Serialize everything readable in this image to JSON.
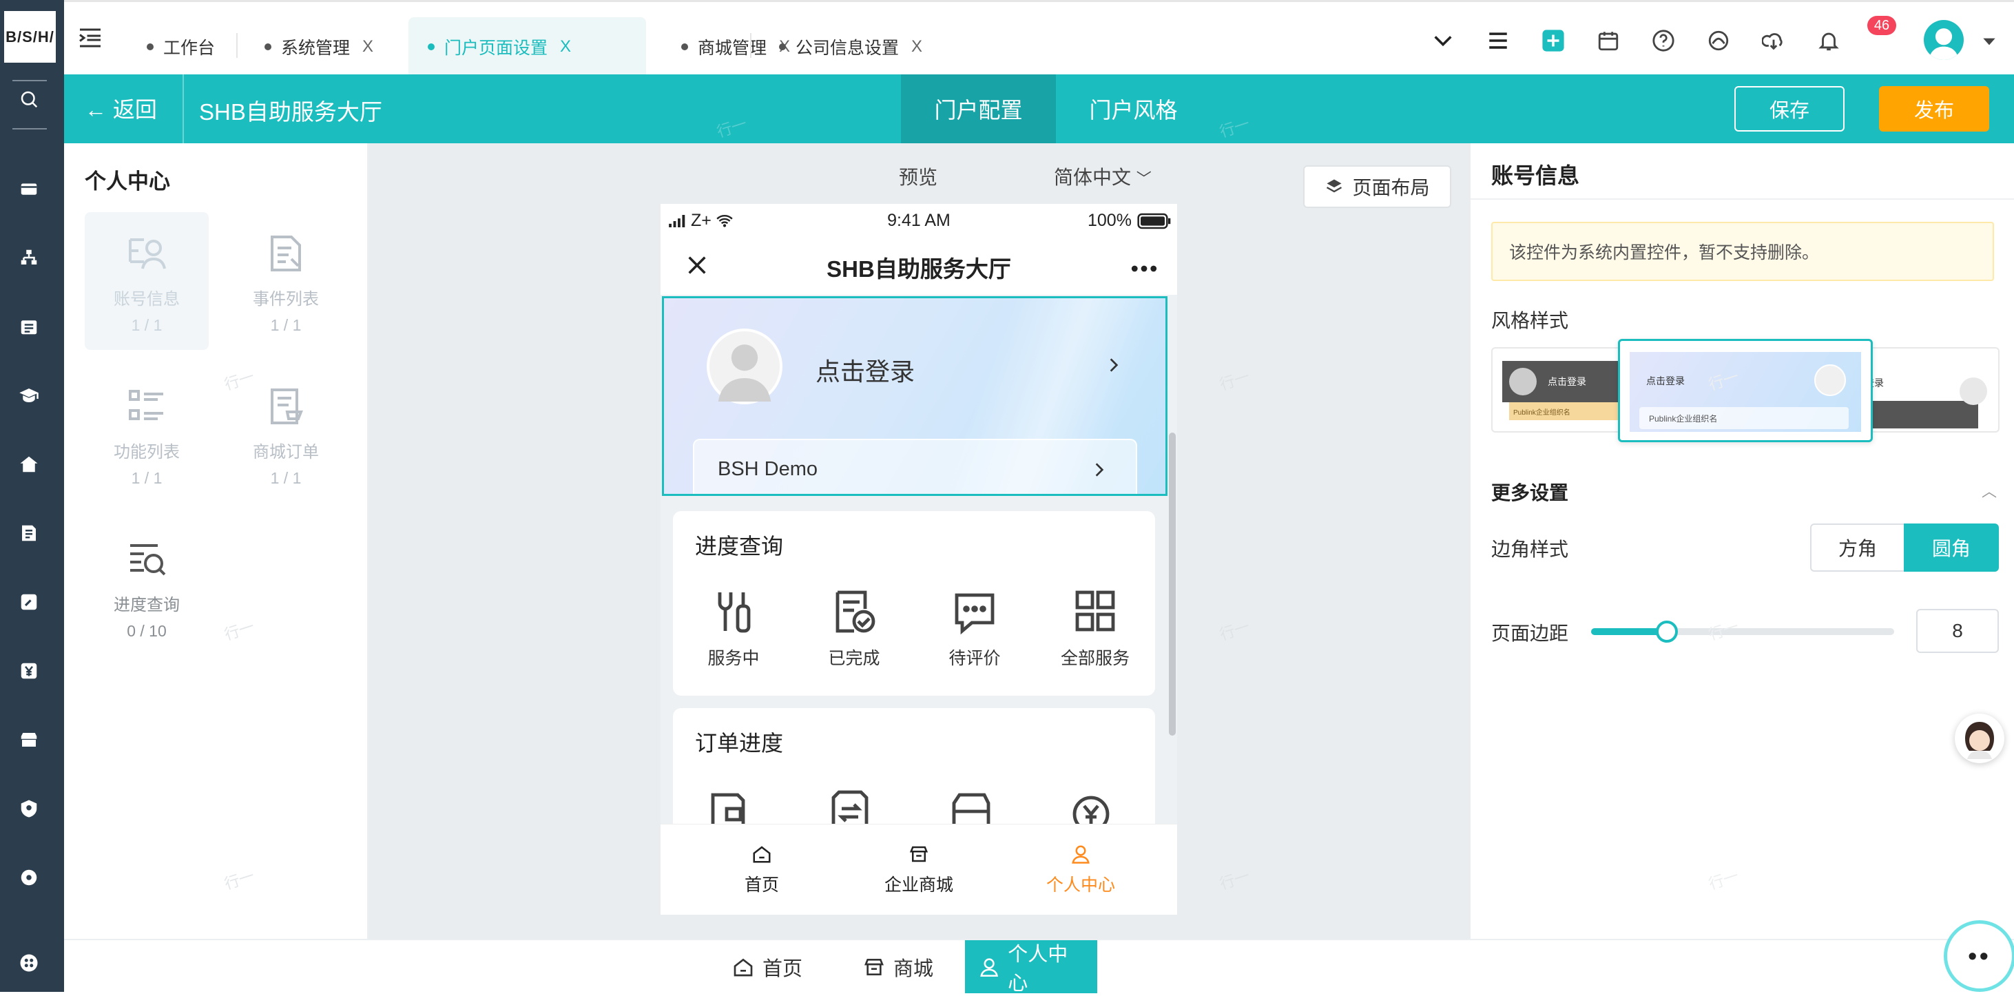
{
  "app": {
    "logo_text": "B/S/H/"
  },
  "tabs": [
    {
      "label": "工作台",
      "closable": false
    },
    {
      "label": "系统管理",
      "closable": true
    },
    {
      "label": "门户页面设置",
      "closable": true,
      "active": true
    },
    {
      "label": "商城管理",
      "closable": true
    },
    {
      "label": "公司信息设置",
      "closable": true
    }
  ],
  "tab_close_glyph": "X",
  "notification_count": "46",
  "header": {
    "back_label": "返回",
    "page_title": "SHB自助服务大厅",
    "config_tab": "门户配置",
    "style_tab": "门户风格",
    "save_label": "保存",
    "publish_label": "发布"
  },
  "left_panel": {
    "title": "个人中心",
    "components": [
      {
        "name": "账号信息",
        "count": "1 / 1",
        "icon": "account-icon"
      },
      {
        "name": "事件列表",
        "count": "1 / 1",
        "icon": "event-list-icon"
      },
      {
        "name": "功能列表",
        "count": "1 / 1",
        "icon": "function-list-icon"
      },
      {
        "name": "商城订单",
        "count": "1 / 1",
        "icon": "mall-order-icon"
      },
      {
        "name": "进度查询",
        "count": "0 / 10",
        "icon": "progress-query-icon"
      }
    ]
  },
  "canvas": {
    "preview_label": "预览",
    "language": "简体中文",
    "layout_button": "页面布局"
  },
  "phone": {
    "carrier": "Z+",
    "time": "9:41 AM",
    "battery": "100%",
    "title": "SHB自助服务大厅",
    "login_text": "点击登录",
    "company": "BSH Demo",
    "progress_card": {
      "title": "进度查询",
      "items": [
        "服务中",
        "已完成",
        "待评价",
        "全部服务"
      ]
    },
    "order_card": {
      "title": "订单进度"
    },
    "tabbar": [
      "首页",
      "企业商城",
      "个人中心"
    ],
    "active_tab_color": "#ff8a1c"
  },
  "right_panel": {
    "title": "账号信息",
    "notice": "该控件为系统内置控件，暂不支持删除。",
    "style_label": "风格样式",
    "style_thumbs": [
      {
        "login": "点击登录",
        "org": "Publink企业组织名"
      },
      {
        "login": "点击登录",
        "org": "Publink企业组织名"
      },
      {
        "login": "登录",
        "org": ""
      }
    ],
    "more_settings": "更多设置",
    "corner_label": "边角样式",
    "corner_options": [
      "方角",
      "圆角"
    ],
    "corner_selected": "圆角",
    "margin_label": "页面边距",
    "margin_value": "8",
    "margin_fraction": 0.25
  },
  "bottom_tabs": [
    "首页",
    "商城",
    "个人中心"
  ],
  "watermark": "行一",
  "float_chat": "••",
  "colors": {
    "accent": "#1cbdbf",
    "publish": "#ffa400",
    "sidebar": "#2c3e4d"
  }
}
